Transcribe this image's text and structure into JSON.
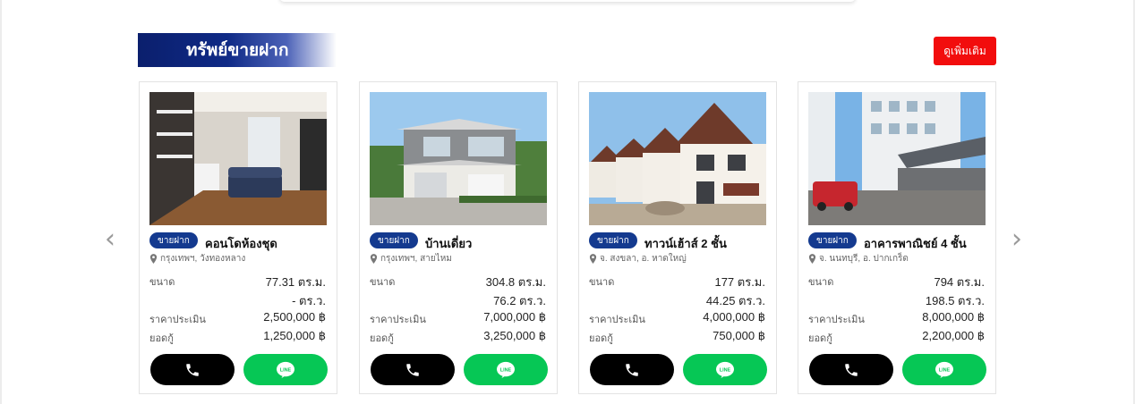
{
  "section": {
    "title": "ทรัพย์ขายฝาก",
    "more_label": "ดูเพิ่มเติม"
  },
  "nav": {
    "prev_icon": "chevron-left-icon",
    "next_icon": "chevron-right-icon"
  },
  "colors": {
    "brand_blue": "#0b1f6d",
    "badge_blue": "#143a8f",
    "more_red": "#f20d0d",
    "line_green": "#06c755",
    "call_black": "#000000"
  },
  "cards": [
    {
      "badge": "ขายฝาก",
      "title": "คอนโดห้องชุด",
      "location": "กรุงเทพฯ, วังทองหลาง",
      "size_label": "ขนาด",
      "size_sqm": "77.31 ตร.ม.",
      "size_sqw": "- ตร.ว.",
      "appraisal_label": "ราคาประเมิน",
      "appraisal": "2,500,000 ฿",
      "loan_label": "ยอดกู้",
      "loan": "1,250,000 ฿"
    },
    {
      "badge": "ขายฝาก",
      "title": "บ้านเดี่ยว",
      "location": "กรุงเทพฯ, สายไหม",
      "size_label": "ขนาด",
      "size_sqm": "304.8 ตร.ม.",
      "size_sqw": "76.2 ตร.ว.",
      "appraisal_label": "ราคาประเมิน",
      "appraisal": "7,000,000 ฿",
      "loan_label": "ยอดกู้",
      "loan": "3,250,000 ฿"
    },
    {
      "badge": "ขายฝาก",
      "title": "ทาวน์เฮ้าส์ 2 ชั้น",
      "location": "จ. สงขลา, อ. หาดใหญ่",
      "size_label": "ขนาด",
      "size_sqm": "177 ตร.ม.",
      "size_sqw": "44.25 ตร.ว.",
      "appraisal_label": "ราคาประเมิน",
      "appraisal": "4,000,000 ฿",
      "loan_label": "ยอดกู้",
      "loan": "750,000 ฿"
    },
    {
      "badge": "ขายฝาก",
      "title": "อาคารพาณิชย์ 4 ชั้น",
      "location": "จ. นนทบุรี, อ. ปากเกร็ด",
      "size_label": "ขนาด",
      "size_sqm": "794 ตร.ม.",
      "size_sqw": "198.5 ตร.ว.",
      "appraisal_label": "ราคาประเมิน",
      "appraisal": "8,000,000 ฿",
      "loan_label": "ยอดกู้",
      "loan": "2,200,000 ฿"
    }
  ]
}
